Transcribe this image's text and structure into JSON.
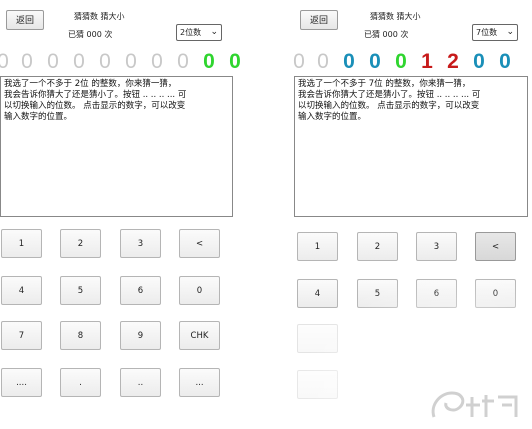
{
  "left": {
    "back_label": "返回",
    "title": "猜猜数 猜大小",
    "guess_count": "已猜 000 次",
    "digits_select": "2位数",
    "digits": [
      "0",
      "0",
      "0",
      "0",
      "0",
      "0",
      "0",
      "0",
      "0",
      "0"
    ],
    "message": "我选了一个不多于 2位 的整数，你来猜一猜，\n我会告诉你猜大了还是猜小了。按钮 .. .. .. ... 可\n以切换输入的位数。 点击显示的数字，可以改变\n输入数字的位置。",
    "keys": [
      "1",
      "2",
      "3",
      "<",
      "4",
      "5",
      "6",
      "0",
      "7",
      "8",
      "9",
      "CHK",
      "....",
      ".",
      " ..",
      "..."
    ]
  },
  "right": {
    "back_label": "返回",
    "title": "猜猜数 猜大小",
    "guess_count": "已猜 000 次",
    "digits_select": "7位数",
    "digits": [
      "0",
      "0",
      "0",
      "0",
      "0",
      "1",
      "2",
      "0",
      "0"
    ],
    "message": "我选了一个不多于 7位 的整数，你来猜一猜，\n我会告诉你猜大了还是猜小了。按钮 .. .. .. ... 可\n以切换输入的位数。 点击显示的数字，可以改变\n输入数字的位置。",
    "keys": [
      "1",
      "2",
      "3",
      "<",
      "4",
      "5",
      "6",
      "0"
    ]
  },
  "colors": {
    "inactive_digit": "#c8c8c8",
    "green_digit": "#2fd52f",
    "blue_digit": "#1a8fb8",
    "red_digit": "#c71a1a"
  }
}
